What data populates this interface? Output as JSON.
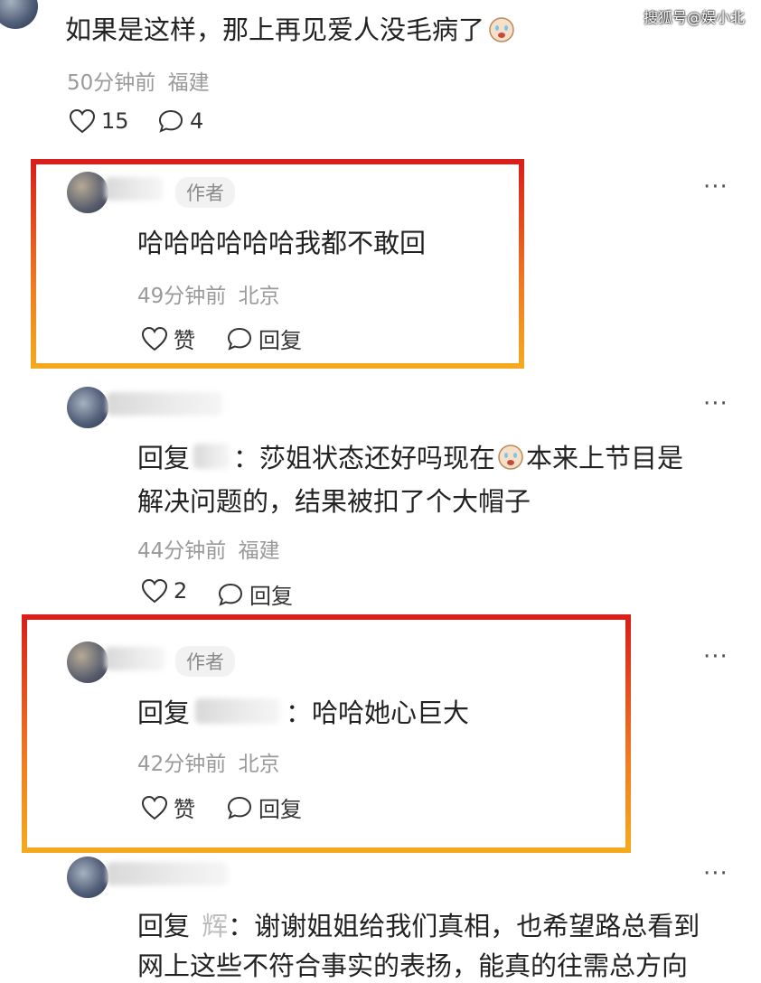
{
  "watermark": "搜狐号@娱小北",
  "top_comment": {
    "text": "如果是这样，那上再见爱人没毛病了",
    "time": "50分钟前",
    "location": "福建",
    "likes": "15",
    "replies": "4"
  },
  "reply1": {
    "badge": "作者",
    "text": "哈哈哈哈哈哈我都不敢回",
    "time": "49分钟前",
    "location": "北京",
    "like_label": "赞",
    "reply_label": "回复"
  },
  "reply2": {
    "prefix": "回复",
    "colon": "：",
    "text_line1": "莎姐状态还好吗现在",
    "text_line1b": "本来上节目是",
    "text_line2": "解决问题的，结果被扣了个大帽子",
    "time": "44分钟前",
    "location": "福建",
    "likes": "2",
    "reply_label": "回复"
  },
  "reply3": {
    "badge": "作者",
    "prefix": "回复",
    "text": "：哈哈她心巨大",
    "time": "42分钟前",
    "location": "北京",
    "like_label": "赞",
    "reply_label": "回复"
  },
  "reply4": {
    "prefix": "回复",
    "target": "辉",
    "text_line1": "：谢谢姐姐给我们真相，也希望路总看到",
    "text_line2": "网上这些不符合事实的表扬，能真的往需总方向"
  },
  "colors": {
    "highlight_top": "#d9201a",
    "highlight_bottom": "#f5a91f"
  }
}
